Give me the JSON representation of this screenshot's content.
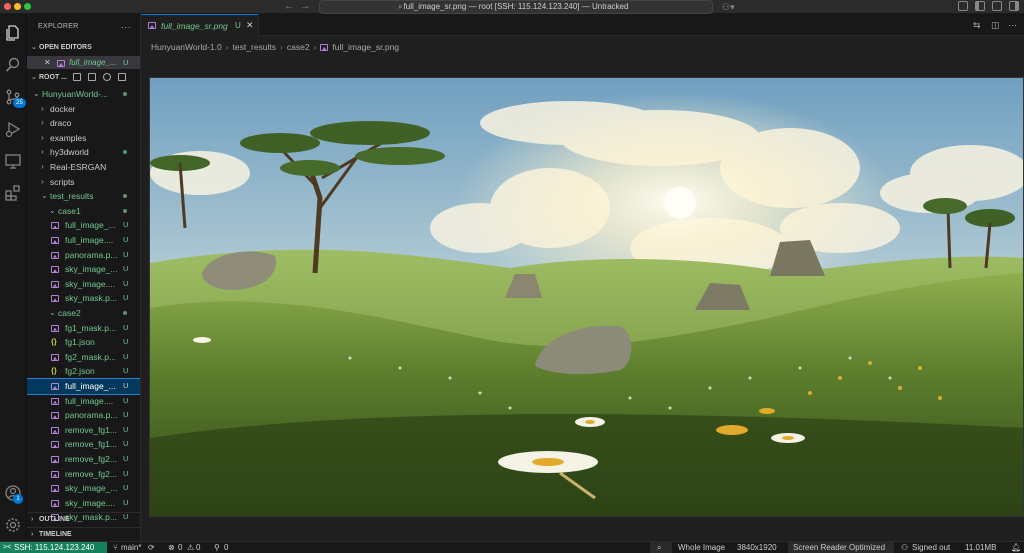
{
  "window": {
    "title": "full_image_sr.png — root [SSH: 115.124.123.240] — Untracked"
  },
  "activity_bar": {
    "items": [
      "explorer-icon",
      "search-icon",
      "source-control-icon",
      "run-debug-icon",
      "remote-explorer-icon",
      "extensions-icon"
    ],
    "source_control_badge": "25",
    "accounts_badge": "1"
  },
  "sidebar": {
    "title": "EXPLORER",
    "more": "···",
    "open_editors_label": "OPEN EDITORS",
    "open_editor": {
      "name": "full_image_...",
      "status": "U"
    },
    "root_label": "ROOT ...",
    "tree": [
      {
        "label": "HunyuanWorld-...",
        "kind": "folder-open",
        "depth": 1,
        "dot": true,
        "green": true
      },
      {
        "label": "docker",
        "kind": "folder",
        "depth": 2
      },
      {
        "label": "draco",
        "kind": "folder",
        "depth": 2
      },
      {
        "label": "examples",
        "kind": "folder",
        "depth": 2
      },
      {
        "label": "hy3dworld",
        "kind": "folder",
        "depth": 2,
        "dot": true
      },
      {
        "label": "Real-ESRGAN",
        "kind": "folder",
        "depth": 2
      },
      {
        "label": "scripts",
        "kind": "folder",
        "depth": 2
      },
      {
        "label": "test_results",
        "kind": "folder-open",
        "depth": 2,
        "dot": true,
        "green": true
      },
      {
        "label": "case1",
        "kind": "folder-open",
        "depth": 3,
        "dot": true,
        "green": true
      },
      {
        "label": "full_image_...",
        "kind": "image",
        "depth": 4,
        "badge": "U",
        "green": true
      },
      {
        "label": "full_image....",
        "kind": "image",
        "depth": 4,
        "badge": "U",
        "green": true
      },
      {
        "label": "panorama.p...",
        "kind": "image",
        "depth": 4,
        "badge": "U",
        "green": true
      },
      {
        "label": "sky_image_...",
        "kind": "image",
        "depth": 4,
        "badge": "U",
        "green": true
      },
      {
        "label": "sky_image....",
        "kind": "image",
        "depth": 4,
        "badge": "U",
        "green": true
      },
      {
        "label": "sky_mask.p...",
        "kind": "image",
        "depth": 4,
        "badge": "U",
        "green": true
      },
      {
        "label": "case2",
        "kind": "folder-open",
        "depth": 3,
        "dot": true,
        "green": true
      },
      {
        "label": "fg1_mask.p...",
        "kind": "image",
        "depth": 4,
        "badge": "U",
        "green": true
      },
      {
        "label": "fg1.json",
        "kind": "json",
        "depth": 4,
        "badge": "U",
        "green": true
      },
      {
        "label": "fg2_mask.p...",
        "kind": "image",
        "depth": 4,
        "badge": "U",
        "green": true
      },
      {
        "label": "fg2.json",
        "kind": "json",
        "depth": 4,
        "badge": "U",
        "green": true
      },
      {
        "label": "full_image_...",
        "kind": "image",
        "depth": 4,
        "badge": "U",
        "selected": true
      },
      {
        "label": "full_image....",
        "kind": "image",
        "depth": 4,
        "badge": "U",
        "green": true
      },
      {
        "label": "panorama.p...",
        "kind": "image",
        "depth": 4,
        "badge": "U",
        "green": true
      },
      {
        "label": "remove_fg1...",
        "kind": "image",
        "depth": 4,
        "badge": "U",
        "green": true
      },
      {
        "label": "remove_fg1...",
        "kind": "image",
        "depth": 4,
        "badge": "U",
        "green": true
      },
      {
        "label": "remove_fg2...",
        "kind": "image",
        "depth": 4,
        "badge": "U",
        "green": true
      },
      {
        "label": "remove_fg2...",
        "kind": "image",
        "depth": 4,
        "badge": "U",
        "green": true
      },
      {
        "label": "sky_image_...",
        "kind": "image",
        "depth": 4,
        "badge": "U",
        "green": true
      },
      {
        "label": "sky_image....",
        "kind": "image",
        "depth": 4,
        "badge": "U",
        "green": true
      },
      {
        "label": "sky_mask.p...",
        "kind": "image",
        "depth": 4,
        "badge": "U",
        "green": true
      }
    ],
    "outline_label": "OUTLINE",
    "timeline_label": "TIMELINE"
  },
  "editor": {
    "tab": {
      "label": "full_image_sr.png",
      "status": "U"
    },
    "breadcrumb": [
      "HunyuanWorld-1.0",
      "test_results",
      "case2",
      "full_image_sr.png"
    ]
  },
  "statusbar": {
    "remote": "SSH: 115.124.123.240",
    "branch": "main*",
    "errors": "0",
    "warnings": "0",
    "ports": "0",
    "zoom": "Whole Image",
    "dimensions": "3840x1920",
    "screen_reader": "Screen Reader Optimized",
    "account": "Signed out",
    "filesize": "11.01MB"
  },
  "colors": {
    "accent": "#0078d4",
    "untracked": "#73c991",
    "remote": "#16825d"
  }
}
